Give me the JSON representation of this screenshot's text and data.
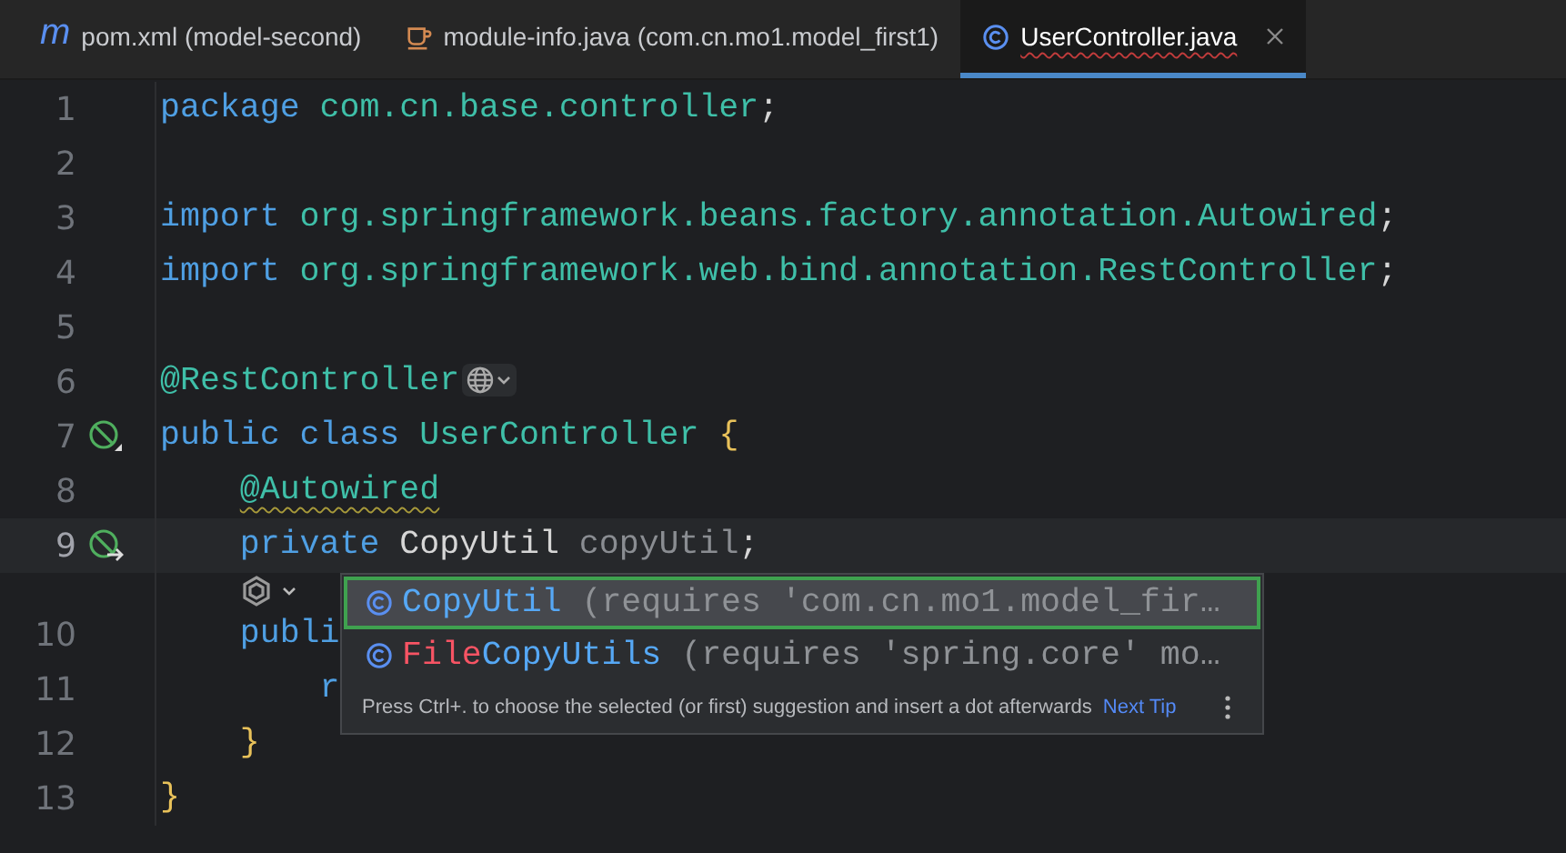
{
  "tabs": [
    {
      "kind": "maven",
      "icon_text": "m",
      "label": "pom.xml (model-second)",
      "selected": false,
      "has_error": false
    },
    {
      "kind": "java-module",
      "label": "module-info.java (com.cn.mo1.model_first1)",
      "selected": false,
      "has_error": false
    },
    {
      "kind": "class",
      "label": "UserController.java",
      "selected": true,
      "has_error": true
    }
  ],
  "lines": [
    {
      "kind": "code",
      "number": "1",
      "current": false,
      "tokens": [
        {
          "text": "package ",
          "kind": "keyword"
        },
        {
          "text": "com.cn.base.controller",
          "kind": "package"
        },
        {
          "text": ";",
          "kind": "punct"
        }
      ]
    },
    {
      "kind": "code",
      "number": "2",
      "current": false
    },
    {
      "kind": "code",
      "number": "3",
      "current": false,
      "tokens": [
        {
          "text": "import ",
          "kind": "keyword"
        },
        {
          "text": "org.springframework.beans.factory.annotation.Autowired",
          "kind": "package"
        },
        {
          "text": ";",
          "kind": "punct"
        }
      ]
    },
    {
      "kind": "code",
      "number": "4",
      "current": false,
      "tokens": [
        {
          "text": "import ",
          "kind": "keyword"
        },
        {
          "text": "org.springframework.web.bind.annotation.RestController",
          "kind": "package"
        },
        {
          "text": ";",
          "kind": "punct"
        }
      ]
    },
    {
      "kind": "code",
      "number": "5",
      "current": false
    },
    {
      "kind": "code",
      "number": "6",
      "current": false,
      "inlay": {
        "kind": "web"
      },
      "tokens": [
        {
          "text": "@RestController",
          "kind": "annotation"
        }
      ]
    },
    {
      "kind": "code",
      "number": "7",
      "current": false,
      "gutter": {
        "kind": "bean"
      },
      "tokens": [
        {
          "text": "public class ",
          "kind": "keyword"
        },
        {
          "text": "UserController ",
          "kind": "class"
        },
        {
          "text": "{",
          "kind": "brace"
        }
      ]
    },
    {
      "kind": "code",
      "number": "8",
      "current": false,
      "tokens": [
        {
          "text": "    @Autowired",
          "kind": "annotation",
          "warning": true
        }
      ]
    },
    {
      "kind": "code",
      "number": "9",
      "current": true,
      "gutter": {
        "kind": "bean-link"
      },
      "tokens": [
        {
          "text": "    private ",
          "kind": "keyword"
        },
        {
          "text": "CopyUtil ",
          "kind": "type"
        },
        {
          "text": "copyUtil",
          "kind": "field"
        },
        {
          "text": ";",
          "kind": "punct"
        }
      ]
    },
    {
      "kind": "hint"
    },
    {
      "kind": "code",
      "number": "10",
      "current": false,
      "tokens": [
        {
          "text": "    publi",
          "kind": "keyword"
        }
      ]
    },
    {
      "kind": "code",
      "number": "11",
      "current": false,
      "tokens": [
        {
          "text": "        r",
          "kind": "keyword"
        }
      ]
    },
    {
      "kind": "code",
      "number": "12",
      "current": false,
      "tokens": [
        {
          "text": "    }",
          "kind": "brace"
        }
      ]
    },
    {
      "kind": "code",
      "number": "13",
      "current": false,
      "tokens": [
        {
          "text": "}",
          "kind": "brace"
        }
      ]
    }
  ],
  "completion": {
    "items": [
      {
        "selected": true,
        "parts": [
          {
            "text": "CopyUtil",
            "kind": "match"
          },
          {
            "text": " (requires 'com.cn.mo1.model_fir…",
            "kind": "detail"
          }
        ]
      },
      {
        "selected": false,
        "parts": [
          {
            "text": "File",
            "kind": "nomatch"
          },
          {
            "text": "CopyUtils",
            "kind": "match"
          },
          {
            "text": " (requires 'spring.core' mo…",
            "kind": "detail"
          }
        ]
      }
    ],
    "hint": "Press Ctrl+. to choose the selected (or first) suggestion and insert a dot afterwards",
    "link": "Next Tip"
  }
}
